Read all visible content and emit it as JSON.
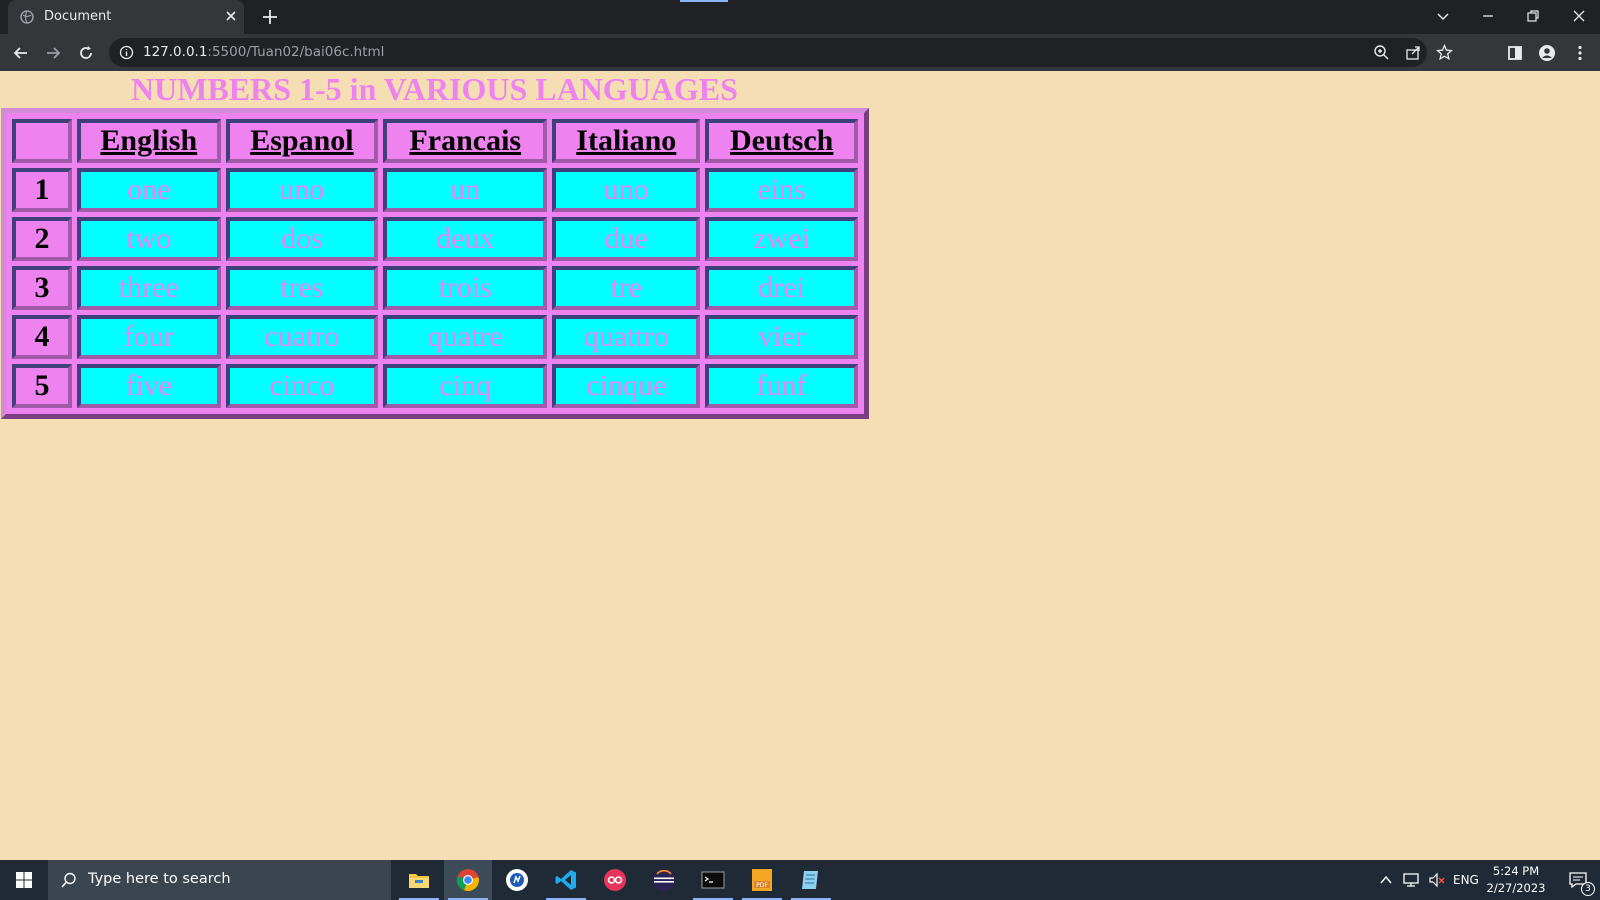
{
  "browser": {
    "tab_title": "Document",
    "url_host": "127.0.0.1",
    "url_rest": ":5500/Tuan02/bai06c.html"
  },
  "page": {
    "title": "NUMBERS 1-5 in VARIOUS LANGUAGES",
    "columns": [
      "English",
      "Espanol",
      "Francais",
      "Italiano",
      "Deutsch"
    ],
    "rows": [
      {
        "num": "1",
        "words": [
          "one",
          "uno",
          "un",
          "uno",
          "eins"
        ]
      },
      {
        "num": "2",
        "words": [
          "two",
          "dos",
          "deux",
          "due",
          "zwei"
        ]
      },
      {
        "num": "3",
        "words": [
          "three",
          "tres",
          "trois",
          "tre",
          "drei"
        ]
      },
      {
        "num": "4",
        "words": [
          "four",
          "cuatro",
          "quatre",
          "quattro",
          "vier"
        ]
      },
      {
        "num": "5",
        "words": [
          "five",
          "cinco",
          "cinq",
          "cinque",
          "funf"
        ]
      }
    ],
    "colors": {
      "background": "#f5deb3",
      "title": "#ee82ee",
      "cell": "#00ffff",
      "header": "#ee82ee"
    }
  },
  "taskbar": {
    "search_placeholder": "Type here to search",
    "language": "ENG",
    "time": "5:24 PM",
    "date": "2/27/2023",
    "notification_count": "3",
    "apps": [
      "file-explorer",
      "chrome",
      "photos-app",
      "vscode",
      "app-red",
      "eclipse",
      "terminal",
      "pdf-app",
      "notepad-app"
    ]
  }
}
